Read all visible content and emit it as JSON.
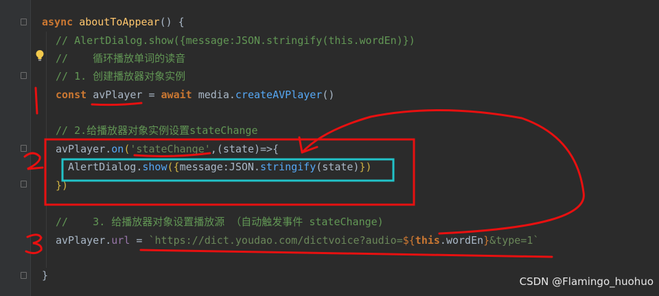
{
  "code": {
    "line1": {
      "kw": "async",
      "fn": "aboutToAppear",
      "rest": "() {"
    },
    "line2": "// AlertDialog.show({message:JSON.stringify(this.wordEn)})",
    "line3": "//    循环播放单词的读音",
    "line4": "// 1. 创建播放器对象实例",
    "line5": {
      "kw": "const",
      "var": "avPlayer",
      "eq": " = ",
      "await": "await",
      "obj": " media.",
      "meth": "createAVPlayer",
      "end": "()"
    },
    "line7": "// 2.给播放器对象实例设置stateChange",
    "line8": {
      "obj": "avPlayer.",
      "meth": "on",
      "open": "(",
      "str": "'stateChange'",
      "rest": ",(state)=>{"
    },
    "line9": {
      "obj": "AlertDialog.",
      "meth": "show",
      "open": "({",
      "mid": "message:JSON.",
      "meth2": "stringify",
      "arg": "(state)",
      "close": "})"
    },
    "line10": "})",
    "line12": "//    3. 给播放器对象设置播放源 （自动触发事件 stateChange)",
    "line13": {
      "obj": "avPlayer.",
      "prop": "url",
      "eq": " = ",
      "tpl_start": "`https://dict.youdao.com/dictvoice?audio=",
      "interp_open": "${",
      "this": "this",
      "interp_rest": ".wordEn",
      "interp_close": "}",
      "tpl_end": "&type=1`"
    },
    "line15": "}"
  },
  "annotations": {
    "n1": "1",
    "n2": "2",
    "n3": "3"
  },
  "watermark": "CSDN @Flamingo_huohuo",
  "icons": [
    "fold-icon",
    "lightbulb-icon"
  ],
  "colors": {
    "red_ink": "#e81010",
    "cyan_box": "#22c3c9"
  }
}
